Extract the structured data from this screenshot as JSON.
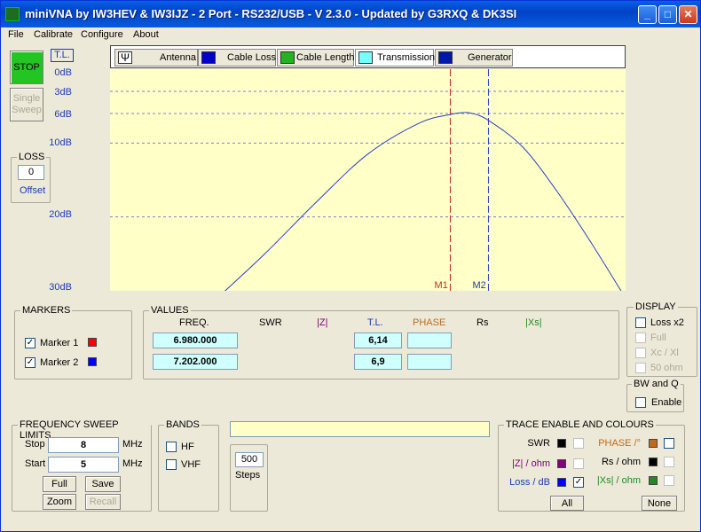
{
  "window": {
    "title": "miniVNA by IW3HEV & IW3IJZ - 2 Port - RS232/USB - V 2.3.0 - Updated by G3RXQ & DK3SI",
    "min_label": "_",
    "max_label": "□",
    "close_label": "✕"
  },
  "menu": [
    "File",
    "Calibrate",
    "Configure",
    "About"
  ],
  "controls": {
    "stop_label": "STOP",
    "single_sweep_label": "Single Sweep",
    "tl_label": "T.L."
  },
  "loss": {
    "title": "LOSS",
    "value": "0",
    "offset_label": "Offset"
  },
  "yaxis": [
    "0dB",
    "3dB",
    "6dB",
    "10dB",
    "20dB",
    "30dB"
  ],
  "tabs": [
    "Antenna",
    "Cable Loss",
    "Cable Length",
    "Transmission",
    "Generator"
  ],
  "markers_chart": {
    "m1": "M1",
    "m2": "M2"
  },
  "markers": {
    "title": "MARKERS",
    "m1_label": "Marker 1",
    "m2_label": "Marker 2",
    "m1_color": "#ff0000",
    "m2_color": "#0000ff"
  },
  "values": {
    "title": "VALUES",
    "headers": [
      "FREQ.",
      "SWR",
      "|Z|",
      "T.L.",
      "PHASE",
      "Rs",
      "|Xs|"
    ],
    "freq1": "6.980.000",
    "freq2": "7.202.000",
    "tl1": "6,14",
    "tl2": "6,9"
  },
  "display": {
    "title": "DISPLAY",
    "loss_x2": "Loss x2",
    "full": "Full",
    "xc_xl": "Xc / Xl",
    "ohm50": "50 ohm"
  },
  "bwq": {
    "title": "BW and Q",
    "enable": "Enable"
  },
  "sweep": {
    "title": "FREQUENCY SWEEP LIMITS",
    "stop_label": "Stop",
    "stop_value": "8",
    "start_label": "Start",
    "start_value": "5",
    "unit": "MHz",
    "full_btn": "Full",
    "save_btn": "Save",
    "zoom_btn": "Zoom",
    "recall_btn": "Recall"
  },
  "bands": {
    "title": "BANDS",
    "hf": "HF",
    "vhf": "VHF"
  },
  "steps": {
    "value": "500",
    "label": "Steps"
  },
  "trace": {
    "title": "TRACE ENABLE AND COLOURS",
    "swr": "SWR",
    "phase": "PHASE /°",
    "z_ohm": "|Z| / ohm",
    "rs_ohm": "Rs / ohm",
    "loss_db": "Loss / dB",
    "xs_ohm": "|Xs| / ohm",
    "all_btn": "All",
    "none_btn": "None",
    "colors": {
      "swr": "#000000",
      "phase": "#c06a1c",
      "z": "#800080",
      "rs": "#000000",
      "loss": "#0000ff",
      "xs": "#1e8c1e"
    }
  },
  "chart_data": {
    "type": "line",
    "x": [
      5.0,
      5.3,
      5.6,
      5.9,
      6.2,
      6.5,
      6.8,
      6.98,
      7.05,
      7.1,
      7.2,
      7.4,
      7.6,
      7.8,
      8.0
    ],
    "series": [
      {
        "values": [
          44,
          38,
          31.5,
          25,
          18,
          11.5,
          7.3,
          6.14,
          5.9,
          5.95,
          6.9,
          10.5,
          16.5,
          23.5,
          31
        ]
      }
    ],
    "ylim": [
      0,
      30
    ],
    "xlim": [
      5,
      8
    ],
    "yticks": [
      0,
      3,
      6,
      10,
      20,
      30
    ],
    "ytick_labels": [
      "0dB",
      "3dB",
      "6dB",
      "10dB",
      "20dB",
      "30dB"
    ],
    "marker1_x": 6.98,
    "marker2_x": 7.202
  }
}
